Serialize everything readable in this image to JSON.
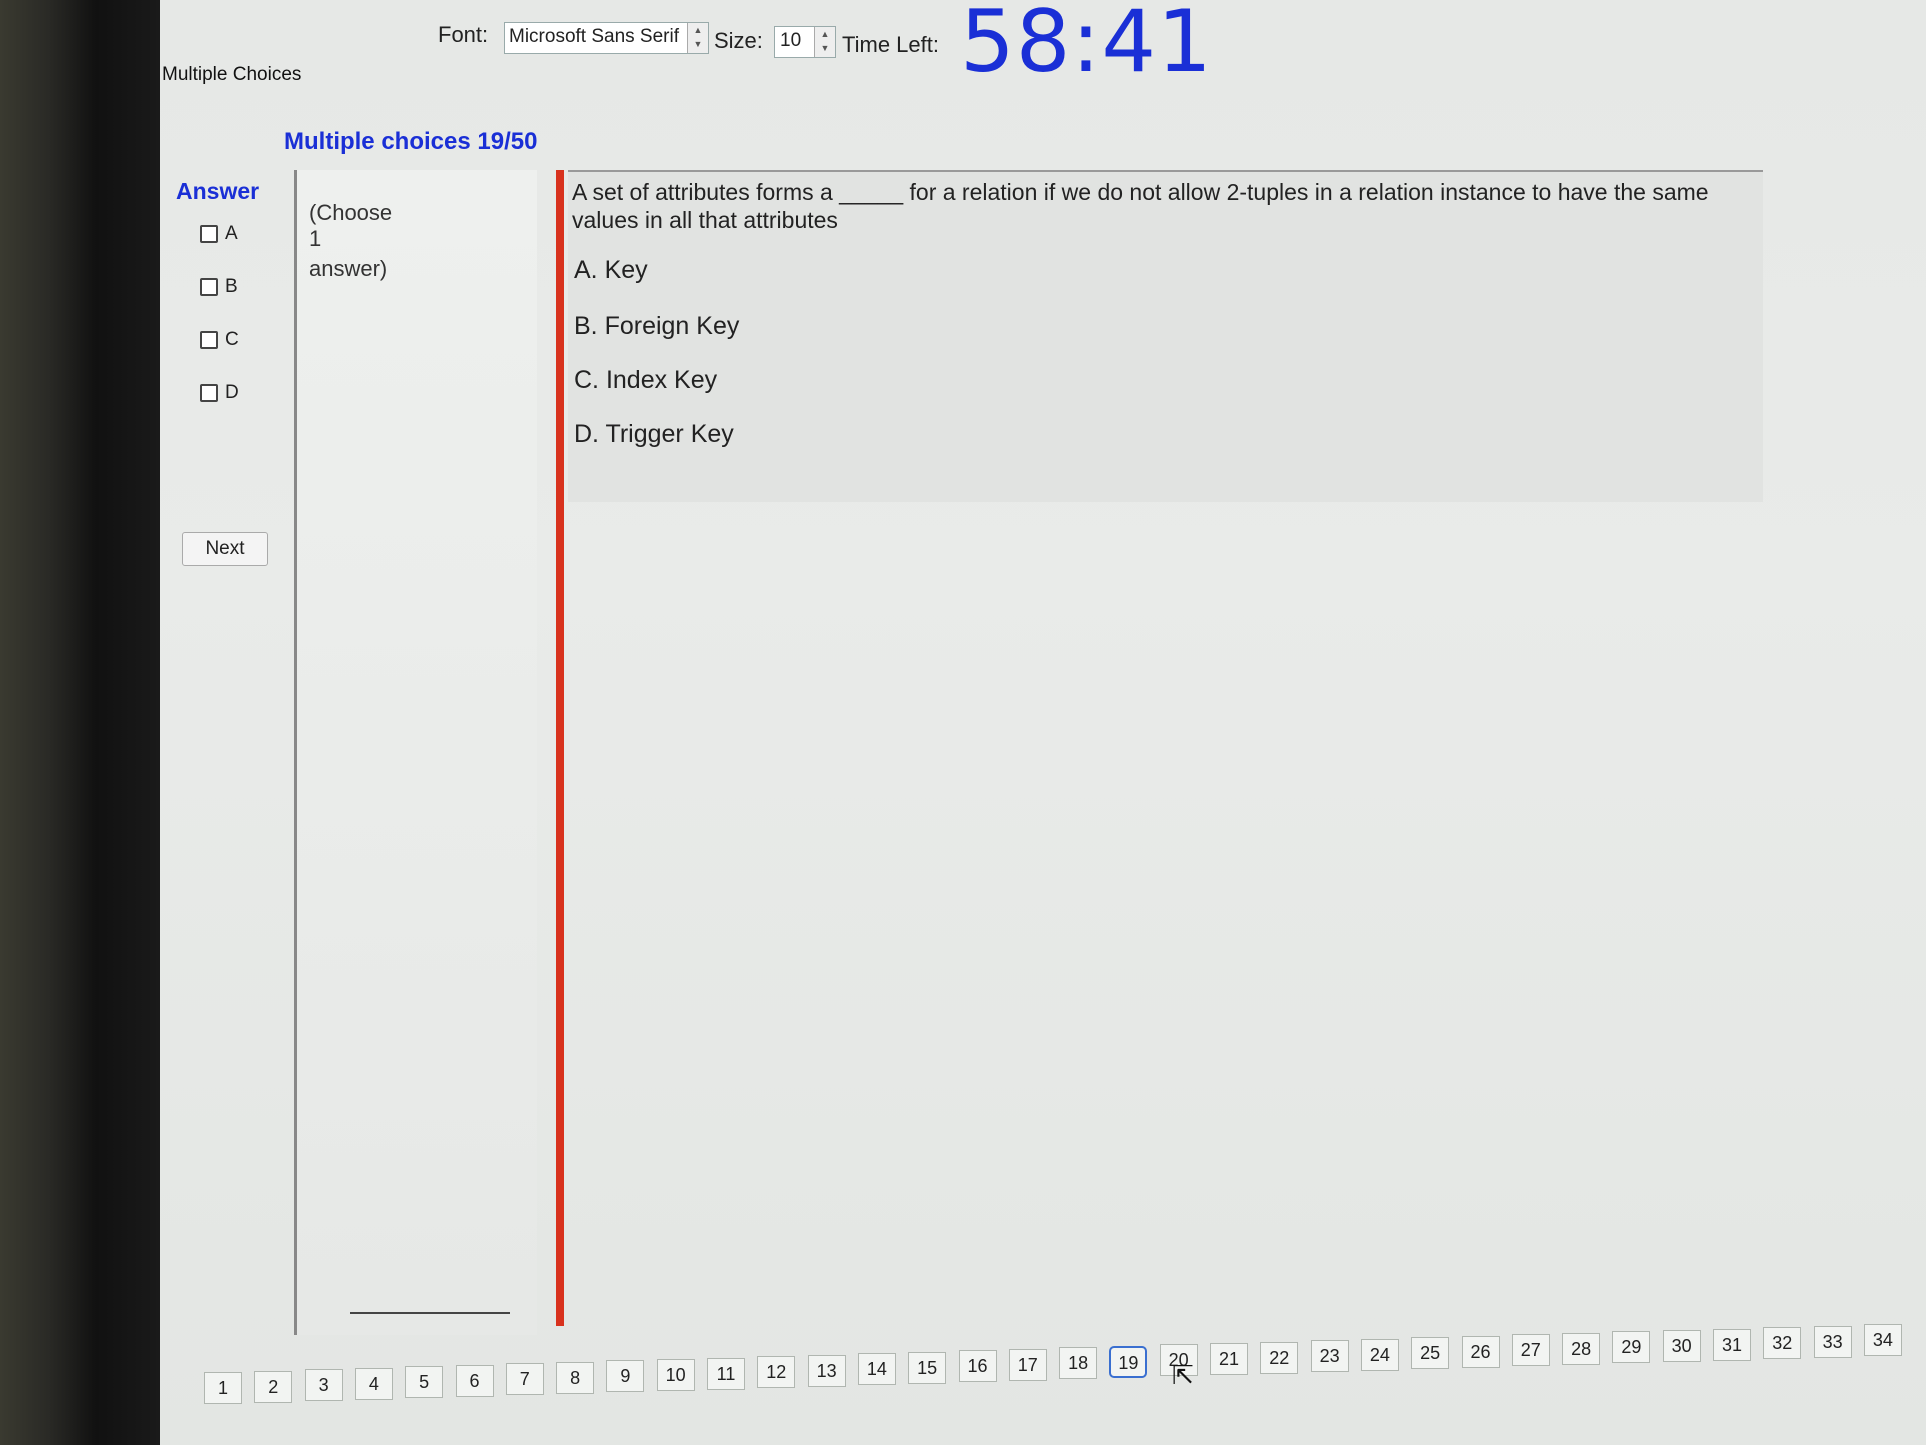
{
  "toolbar": {
    "font_label": "Font:",
    "font_value": "Microsoft Sans Serif",
    "size_label": "Size:",
    "size_value": "10",
    "time_label": "Time Left:",
    "time_value": "58:41"
  },
  "section_tab": "Multiple Choices",
  "heading": "Multiple choices 19/50",
  "answer": {
    "heading": "Answer",
    "options": [
      "A",
      "B",
      "C",
      "D"
    ],
    "next_label": "Next"
  },
  "hint": {
    "line1": "(Choose",
    "line2": "1",
    "line3": "answer)"
  },
  "question": {
    "text": "A set of attributes forms a _____ for a relation if we do not allow 2-tuples in a relation instance to have the same values in all that attributes",
    "choices": [
      "A.  Key",
      "B.  Foreign Key",
      "C.  Index Key",
      "D.  Trigger Key"
    ]
  },
  "pages": [
    "1",
    "2",
    "3",
    "4",
    "5",
    "6",
    "7",
    "8",
    "9",
    "10",
    "11",
    "12",
    "13",
    "14",
    "15",
    "16",
    "17",
    "18",
    "19",
    "20",
    "21",
    "22",
    "23",
    "24",
    "25",
    "26",
    "27",
    "28",
    "29",
    "30",
    "31",
    "32",
    "33",
    "34"
  ],
  "current_page": "19"
}
